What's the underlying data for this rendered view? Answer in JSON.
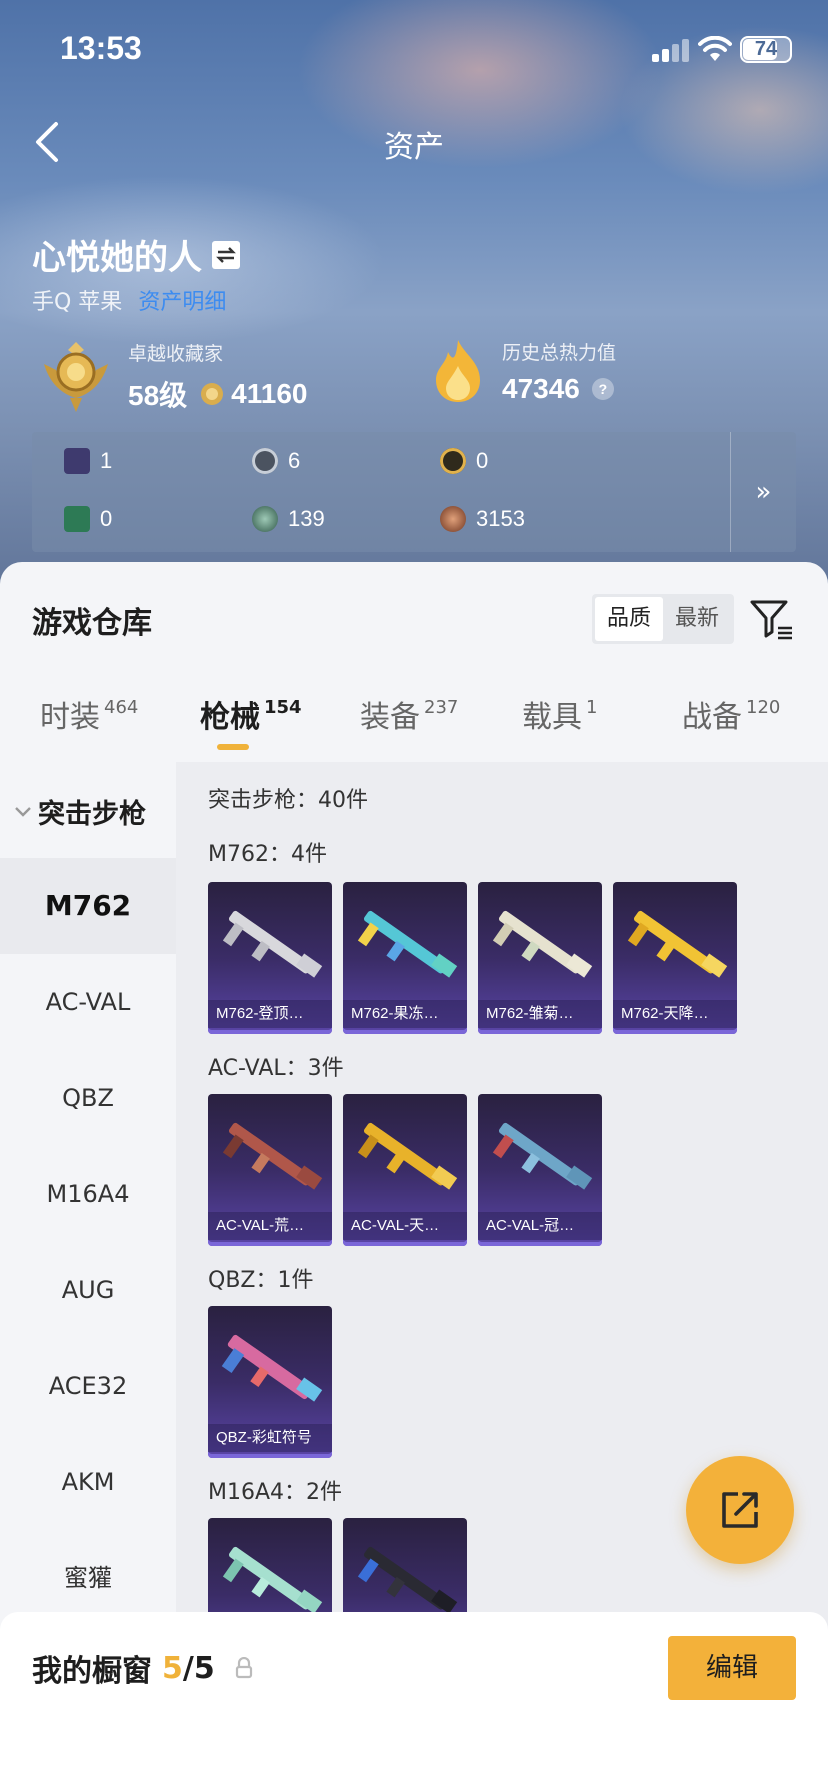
{
  "status_bar": {
    "time": "13:53",
    "battery": "74",
    "battery_level_percent": 74
  },
  "nav": {
    "title": "资产",
    "back_icon": "chevron-left-icon"
  },
  "user": {
    "name": "心悦她的人",
    "platform": "手Q 苹果",
    "link_text": "资产明细"
  },
  "collector": {
    "label": "卓越收藏家",
    "level": "58级",
    "points": "41160"
  },
  "heat": {
    "label": "历史总热力值",
    "value": "47346",
    "help": "?"
  },
  "resources": [
    {
      "icon": "purple-card-icon",
      "value": "1"
    },
    {
      "icon": "silver-coin-icon",
      "value": "6"
    },
    {
      "icon": "gold-coin-icon",
      "value": "0"
    },
    {
      "icon": "green-card-icon",
      "value": "0"
    },
    {
      "icon": "green-gem-icon",
      "value": "139"
    },
    {
      "icon": "bronze-coin-icon",
      "value": "3153"
    }
  ],
  "resources_more": "»",
  "warehouse": {
    "title": "游戏仓库",
    "sort_options": [
      "品质",
      "最新"
    ],
    "sort_selected": "品质"
  },
  "tabs": [
    {
      "label": "时装",
      "count": "464"
    },
    {
      "label": "枪械",
      "count": "154",
      "active": true
    },
    {
      "label": "装备",
      "count": "237"
    },
    {
      "label": "载具",
      "count": "1"
    },
    {
      "label": "战备",
      "count": "120"
    }
  ],
  "category": {
    "name": "突击步枪",
    "summary": "突击步枪：40件"
  },
  "side_nav": [
    "M762",
    "AC-VAL",
    "QBZ",
    "M16A4",
    "AUG",
    "ACE32",
    "AKM",
    "蜜獾"
  ],
  "sections": [
    {
      "label": "M762：4件",
      "items": [
        "M762-登顶…",
        "M762-果冻…",
        "M762-雏菊…",
        "M762-天降…"
      ]
    },
    {
      "label": "AC-VAL：3件",
      "items": [
        "AC-VAL-荒…",
        "AC-VAL-天…",
        "AC-VAL-冠…"
      ]
    },
    {
      "label": "QBZ：1件",
      "items": [
        "QBZ-彩虹符号"
      ]
    },
    {
      "label": "M16A4：2件",
      "items": [
        "",
        ""
      ]
    }
  ],
  "showcase": {
    "label": "我的橱窗",
    "count": "5",
    "total": "/5",
    "edit": "编辑"
  },
  "colors": {
    "accent": "#f3b13a",
    "link": "#3d8cf0",
    "card_bg": "#3a2c66"
  }
}
